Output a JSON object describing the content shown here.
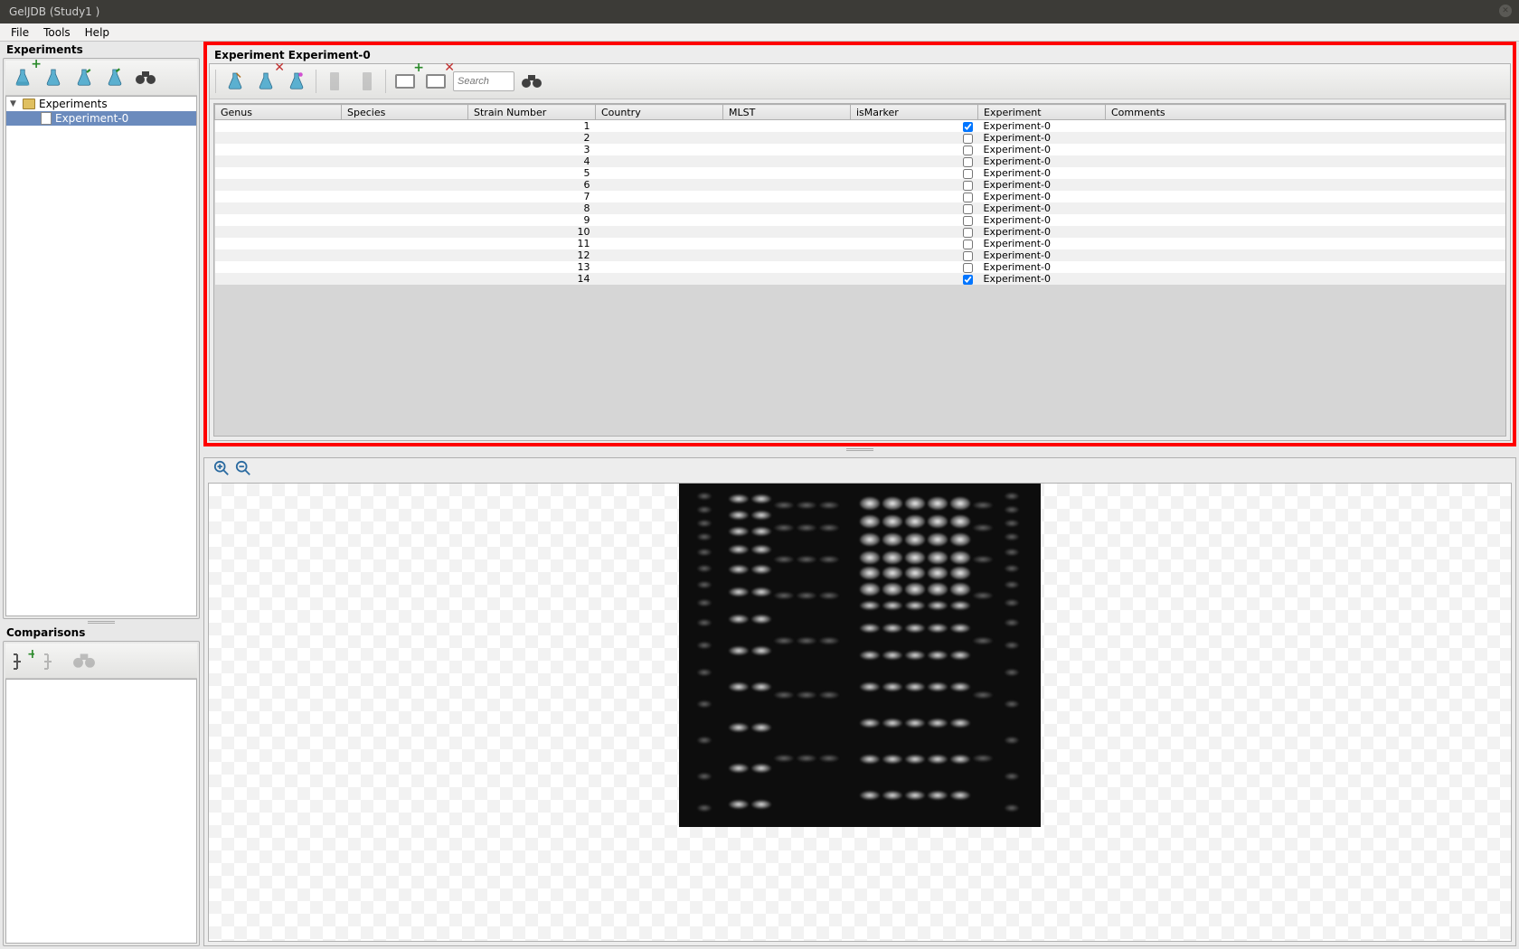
{
  "window": {
    "title": "GelJDB (Study1 )"
  },
  "menubar": {
    "items": [
      "File",
      "Tools",
      "Help"
    ]
  },
  "sidebar": {
    "experiments": {
      "title": "Experiments",
      "root_label": "Experiments",
      "items": [
        {
          "label": "Experiment-0",
          "selected": true
        }
      ]
    },
    "comparisons": {
      "title": "Comparisons"
    }
  },
  "experiment_panel": {
    "title": "Experiment Experiment-0",
    "search_placeholder": "Search",
    "columns": [
      "Genus",
      "Species",
      "Strain Number",
      "Country",
      "MLST",
      "isMarker",
      "Experiment",
      "Comments"
    ],
    "rows": [
      {
        "strain": "1",
        "isMarker": true,
        "experiment": "Experiment-0"
      },
      {
        "strain": "2",
        "isMarker": false,
        "experiment": "Experiment-0"
      },
      {
        "strain": "3",
        "isMarker": false,
        "experiment": "Experiment-0"
      },
      {
        "strain": "4",
        "isMarker": false,
        "experiment": "Experiment-0"
      },
      {
        "strain": "5",
        "isMarker": false,
        "experiment": "Experiment-0"
      },
      {
        "strain": "6",
        "isMarker": false,
        "experiment": "Experiment-0"
      },
      {
        "strain": "7",
        "isMarker": false,
        "experiment": "Experiment-0"
      },
      {
        "strain": "8",
        "isMarker": false,
        "experiment": "Experiment-0"
      },
      {
        "strain": "9",
        "isMarker": false,
        "experiment": "Experiment-0"
      },
      {
        "strain": "10",
        "isMarker": false,
        "experiment": "Experiment-0"
      },
      {
        "strain": "11",
        "isMarker": false,
        "experiment": "Experiment-0"
      },
      {
        "strain": "12",
        "isMarker": false,
        "experiment": "Experiment-0"
      },
      {
        "strain": "13",
        "isMarker": false,
        "experiment": "Experiment-0"
      },
      {
        "strain": "14",
        "isMarker": true,
        "experiment": "Experiment-0"
      }
    ]
  }
}
